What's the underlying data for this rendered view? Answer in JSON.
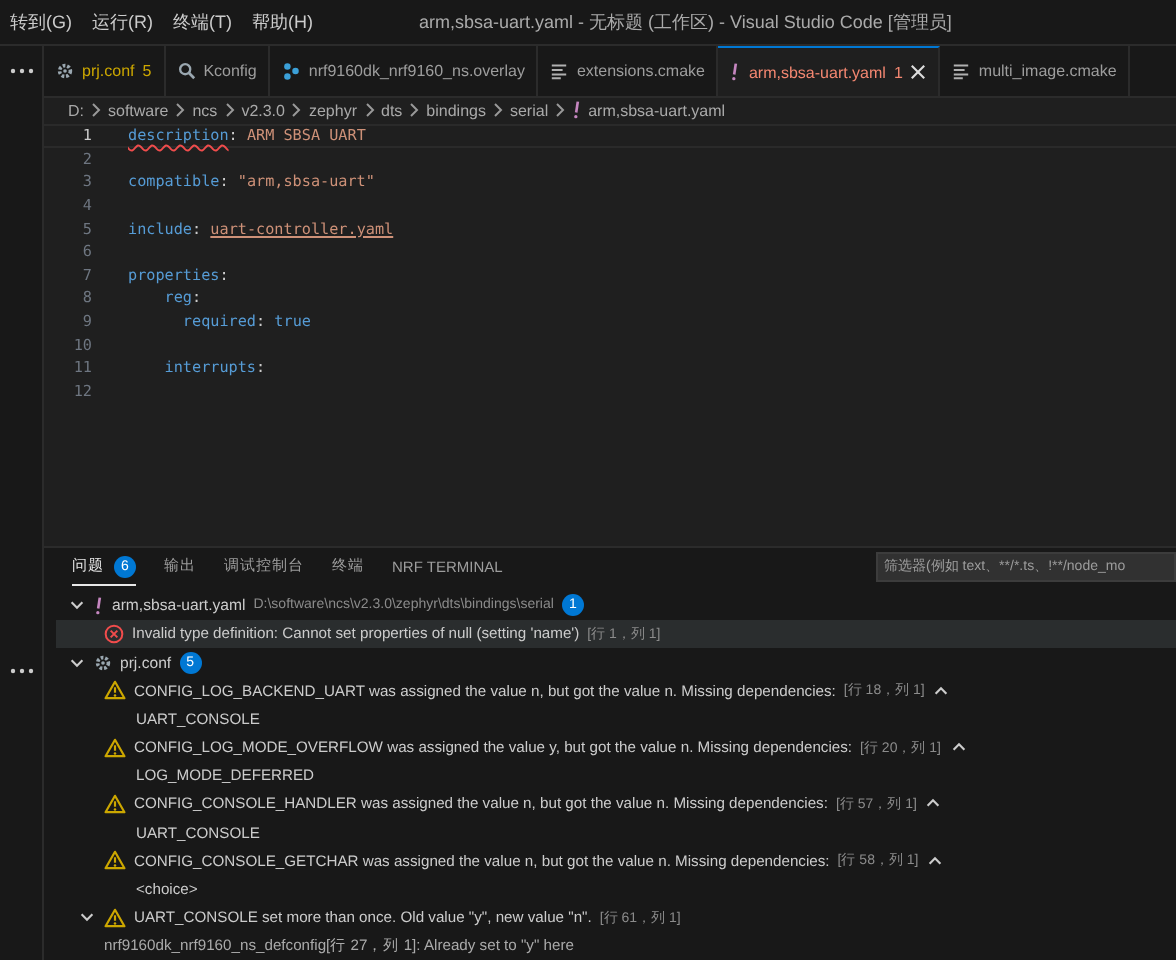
{
  "menu": [
    "转到(G)",
    "运行(R)",
    "终端(T)",
    "帮助(H)"
  ],
  "window": {
    "title": "arm,sbsa-uart.yaml - 无标题 (工作区) - Visual Studio Code [管理员]"
  },
  "tabs": [
    {
      "label": "prj.conf",
      "kind": "gear",
      "warning": true,
      "error": false,
      "count": "5",
      "selected": false
    },
    {
      "label": "Kconfig",
      "kind": "search",
      "warning": false,
      "error": false,
      "selected": false
    },
    {
      "label": "nrf9160dk_nrf9160_ns.overlay",
      "kind": "tree",
      "warning": false,
      "error": false,
      "selected": false
    },
    {
      "label": "extensions.cmake",
      "kind": "lines",
      "warning": false,
      "error": false,
      "selected": false
    },
    {
      "label": "arm,sbsa-uart.yaml",
      "kind": "bang",
      "warning": false,
      "error": true,
      "count": "1",
      "selected": true
    },
    {
      "label": "multi_image.cmake",
      "kind": "lines",
      "warning": false,
      "error": false,
      "selected": false
    }
  ],
  "breadcrumbs": [
    "D:",
    "software",
    "ncs",
    "v2.3.0",
    "zephyr",
    "dts",
    "bindings",
    "serial",
    "arm,sbsa-uart.yaml"
  ],
  "editor": {
    "lines": [
      {
        "number": "1",
        "current": true,
        "tokens": [
          {
            "text": "description",
            "kind": "key",
            "squiggle": true
          },
          {
            "text": ": ",
            "kind": "punct"
          },
          {
            "text": "ARM SBSA UART",
            "kind": "string"
          }
        ]
      },
      {
        "number": "2",
        "current": false
      },
      {
        "number": "3",
        "current": false,
        "tokens": [
          {
            "text": "compatible",
            "kind": "key"
          },
          {
            "text": ": ",
            "kind": "punct"
          },
          {
            "text": "\"arm,sbsa-uart\"",
            "kind": "string"
          }
        ]
      },
      {
        "number": "4",
        "current": false
      },
      {
        "number": "5",
        "current": false,
        "tokens": [
          {
            "text": "include",
            "kind": "key"
          },
          {
            "text": ": ",
            "kind": "punct"
          },
          {
            "text": "uart-controller.yaml",
            "kind": "link"
          }
        ]
      },
      {
        "number": "6",
        "current": false
      },
      {
        "number": "7",
        "current": false,
        "tokens": [
          {
            "text": "properties",
            "kind": "key"
          },
          {
            "text": ":",
            "kind": "punct"
          }
        ]
      },
      {
        "number": "8",
        "current": false,
        "tokens": [
          {
            "text": "    reg",
            "kind": "key"
          },
          {
            "text": ":",
            "kind": "punct"
          }
        ]
      },
      {
        "number": "9",
        "current": false,
        "tokens": [
          {
            "text": "      required",
            "kind": "key"
          },
          {
            "text": ": ",
            "kind": "punct"
          },
          {
            "text": "true",
            "kind": "bool"
          }
        ]
      },
      {
        "number": "10",
        "current": false
      },
      {
        "number": "11",
        "current": false,
        "tokens": [
          {
            "text": "    interrupts",
            "kind": "key"
          },
          {
            "text": ":",
            "kind": "punct"
          }
        ]
      },
      {
        "number": "12",
        "current": false
      }
    ]
  },
  "panel": {
    "tabs": [
      {
        "label": "问题",
        "count": "6",
        "selected": true
      },
      {
        "label": "输出",
        "selected": false
      },
      {
        "label": "调试控制台",
        "selected": false
      },
      {
        "label": "终端",
        "selected": false
      },
      {
        "label": "NRF TERMINAL",
        "selected": false
      }
    ],
    "filter": {
      "placeholder": "筛选器(例如 text、**/*.ts、!**/node_mo"
    },
    "groups": [
      {
        "file": "arm,sbsa-uart.yaml",
        "kind": "bang",
        "path": "D:\\software\\ncs\\v2.3.0\\zephyr\\dts\\bindings\\serial",
        "count": "1",
        "expanded": true,
        "items": [
          {
            "kind": "error",
            "message": "Invalid type definition: Cannot set properties of null (setting 'name')",
            "location": "[行 1，列 1]",
            "selected": true
          }
        ]
      },
      {
        "file": "prj.conf",
        "kind": "gear",
        "count": "5",
        "expanded": true,
        "items": [
          {
            "kind": "warning",
            "message": "CONFIG_LOG_BACKEND_UART was assigned the value n, but got the value n. Missing dependencies:",
            "location": "[行 18，列 1]",
            "detail": "UART_CONSOLE",
            "selected": false
          },
          {
            "kind": "warning",
            "message": "CONFIG_LOG_MODE_OVERFLOW was assigned the value y, but got the value n. Missing dependencies:",
            "location": "[行 20，列 1]",
            "detail": "LOG_MODE_DEFERRED",
            "selected": false
          },
          {
            "kind": "warning",
            "message": "CONFIG_CONSOLE_HANDLER was assigned the value n, but got the value n. Missing dependencies:",
            "location": "[行 57，列 1]",
            "detail": "UART_CONSOLE",
            "selected": false
          },
          {
            "kind": "warning",
            "message": "CONFIG_CONSOLE_GETCHAR was assigned the value n, but got the value n. Missing dependencies:",
            "location": "[行 58，列 1]",
            "detail": "<choice>",
            "selected": false
          },
          {
            "kind": "warning",
            "message": "UART_CONSOLE set more than once. Old value \"y\", new value \"n\".",
            "location": "[行 61，列 1]",
            "expanded": true,
            "related": [
              "nrf9160dk_nrf9160_ns_defconfig[行 27，列 1]: Already set to \"y\" here"
            ],
            "selected": false
          }
        ]
      }
    ]
  }
}
